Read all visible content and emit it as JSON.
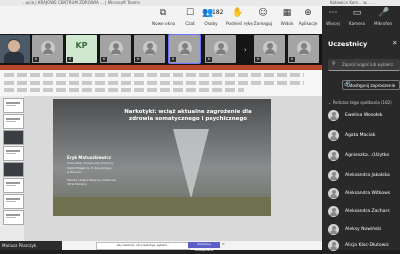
{
  "window": {
    "title": "...ęcia | KRAJOWE CENTRUM ZDROWIA ... | Microsoft Teams",
    "right_title": "Katowice Kom... w... ..."
  },
  "toolbar": {
    "new_window_label": "Nowe okno",
    "chat_label": "Czat",
    "people_label": "Osoby",
    "people_count": "182",
    "raise_hand_label": "Podnieś rękę",
    "react_label": "Zareaguj",
    "view_label": "Widok",
    "apps_label": "Aplikacje",
    "more_label": "Więcej",
    "camera_label": "Kamera",
    "mic_label": "Mikrofon"
  },
  "gallery": {
    "initials_tile": "KP"
  },
  "presentation": {
    "slide": {
      "title": "Narkotyki: wciąż aktualne zagrożenie dla zdrowia somatycznego i psychicznego",
      "author": "Eryk Matuszkiewicz",
      "affiliation": "Internista, toksykolog kliniczny",
      "lines": [
        "Szpital Miejski im. H. Święcickiego",
        "w Poznaniu",
        "Katedra i Zakład Medycyny Rodzinnej",
        "UM w Poznaniu"
      ]
    },
    "notification_text": "Aby zobaczyć, kto prezentuje, wybierz...",
    "notification_button": "Zatrzymaj udostępnianie",
    "speaker_name": "Mariusz Pilarczyk"
  },
  "participants_panel": {
    "title": "Uczestnicy",
    "search_placeholder": "Zaproś kogoś lub wybierz",
    "share_invite_label": "Udostępnij zaproszenie",
    "section_label": "Podczas tego spotkania (182)",
    "people": [
      "Ewelina Wesołek",
      "Agata Maciak",
      "Agnieszka...(Użytko",
      "Aleksandra Jakalska",
      "Aleksandra Witkows",
      "Aleksandra Zachars",
      "Aleksy Nowiński",
      "Alicja Kloc-Dłutowic"
    ]
  },
  "colors": {
    "accent": "#5b5fc7",
    "powerpoint": "#b7472a",
    "panel_bg": "#292929"
  },
  "icons": [
    "new-window-icon",
    "chat-icon",
    "people-icon",
    "raise-hand-icon",
    "react-icon",
    "view-icon",
    "apps-icon",
    "more-icon",
    "camera-icon",
    "mic-icon",
    "close-icon",
    "search-icon",
    "share-icon",
    "chevron-right-icon",
    "mic-off-icon"
  ]
}
